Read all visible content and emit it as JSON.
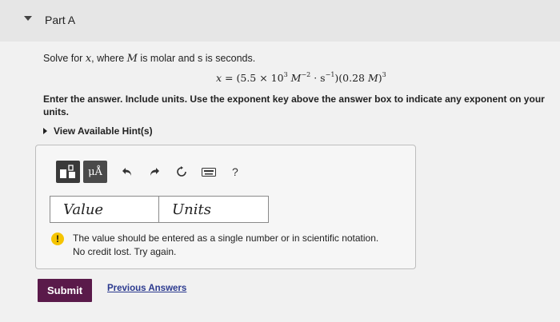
{
  "part": {
    "title": "Part A"
  },
  "question": {
    "prefix": "Solve for ",
    "var_x": "x",
    "middle": ", where ",
    "var_M": "M",
    "suffix": " is molar and s is seconds."
  },
  "equation": {
    "lhs": "x",
    "eq": " = (5.5 × 10",
    "exp3": "3",
    "sp1": " ",
    "M": "M",
    "expneg2": "−2",
    "dot_s": " · s",
    "expneg1": "−1",
    "mid": ")(0.28 ",
    "M2": "M",
    "close": ")",
    "exp3b": "3"
  },
  "instructions": "Enter the answer. Include units. Use the exponent key above the answer box to indicate any exponent on your units.",
  "hint": {
    "label": "View Available Hint(s)"
  },
  "toolbar": {
    "mu_label": "μÅ",
    "help_label": "?"
  },
  "answer": {
    "value_placeholder": "Value",
    "units_placeholder": "Units"
  },
  "feedback": {
    "line1": "The value should be entered as a single number or in scientific notation.",
    "line2": "No credit lost. Try again."
  },
  "submit_label": "Submit",
  "previous_answers_label": "Previous Answers",
  "colors": {
    "submit_bg": "#5a1a4a",
    "link": "#2b3a8f",
    "warning": "#f5c400"
  }
}
